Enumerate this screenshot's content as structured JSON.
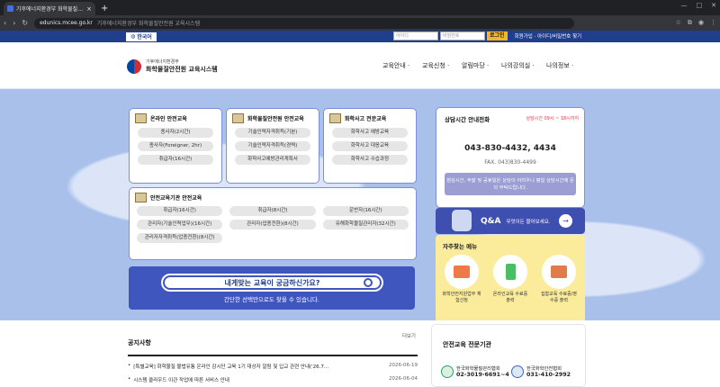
{
  "browser": {
    "tab_title": "기후에너지환경부 화학물질안전",
    "tab_close": "×",
    "new_tab": "+",
    "back": "‹",
    "forward": "›",
    "reload": "↻",
    "url": "edunics.mcee.go.kr",
    "page_title": "기후에너지환경부 화학물질안전원 교육시스템",
    "win_minimize": "—",
    "win_maximize": "□",
    "win_close": "✕"
  },
  "topbar": {
    "lang_label": "한국어",
    "id_placeholder": "아이디",
    "pw_placeholder": "비밀번호",
    "login_label": "로그인",
    "links": "회원가입 · 아이디/비밀번호 찾기"
  },
  "header": {
    "org_line": "기후에너지환경부",
    "site_name": "화학물질안전원 교육시스템",
    "nav": [
      "교육안내 ·",
      "교육신청 ·",
      "알림마당 ·",
      "나의강의실 ·",
      "나의정보 ·"
    ]
  },
  "cards": {
    "online": {
      "title": "온라인 안전교육",
      "items": [
        "종사자(2시간)",
        "종사자(Foreigner, 2hr)",
        "취급자(16시간)"
      ]
    },
    "institute": {
      "title": "화학물질안전원 안전교육",
      "items": [
        "기술인력자격취득(기본)",
        "기술인력자격취득(경력)",
        "화학사고예방관리계획서"
      ]
    },
    "accident": {
      "title": "화학사고 전문교육",
      "items": [
        "화학사고 예방교육",
        "화학사고 대응교육",
        "화학사고 수습과정"
      ]
    },
    "institution": {
      "title": "안전교육기관 안전교육",
      "items": [
        "취급자(16시간)",
        "취급자(8시간)",
        "운반자(16시간)",
        "관리자(기술인력업무)(16시간)",
        "관리자(업종전환)(8시간)",
        "유해화학물질관리자(32시간)",
        "관리자자격취득(업종전환)(8시간)"
      ]
    }
  },
  "search": {
    "title": "내게맞는 교육이 궁금하신가요?",
    "subtitle": "간단한 선택만으로도 찾을 수 있습니다."
  },
  "contact": {
    "title": "상담시간 안내전화",
    "hours": "상담시간 09시 ~ 18시까지",
    "phone": "043-830-4432, 4434",
    "fax": "FAX. 043)830-4499",
    "note": "점심시간, 주말 및 공휴일은 상담이 어려우니 평일 상담시간에 문의 부탁드립니다."
  },
  "qna": {
    "title": "Q&A",
    "subtitle": "무엇이든 물어보세요.",
    "arrow": "→"
  },
  "faq": {
    "title": "자주찾는 메뉴",
    "items": [
      {
        "label": "화학안전지원업무 체험신청",
        "color": "#ef7a49"
      },
      {
        "label": "온라인교육 수료증 출력",
        "color": "#4bbd64"
      },
      {
        "label": "집합교육 수료증/영수증 출력",
        "color": "#e27b4b"
      }
    ]
  },
  "notices": {
    "title": "공지사항",
    "more": "더보기",
    "rows": [
      {
        "text": "[특별교육] 화학물질 불법유통 온라인 감시단 교육 1기 대상자 알림 및 입교 관련 안내('26.7...",
        "date": "2026-06-19"
      },
      {
        "text": "시스템 클라우드 이관 작업에 따른 서비스 안내",
        "date": "2026-06-04"
      }
    ]
  },
  "orgs": {
    "title": "안전교육 전문기관",
    "items": [
      {
        "name": "한국화학물질관리협회",
        "phone": "02-3019-6691~4"
      },
      {
        "name": "한국화학안전협회",
        "phone": "031-410-2992"
      }
    ]
  }
}
